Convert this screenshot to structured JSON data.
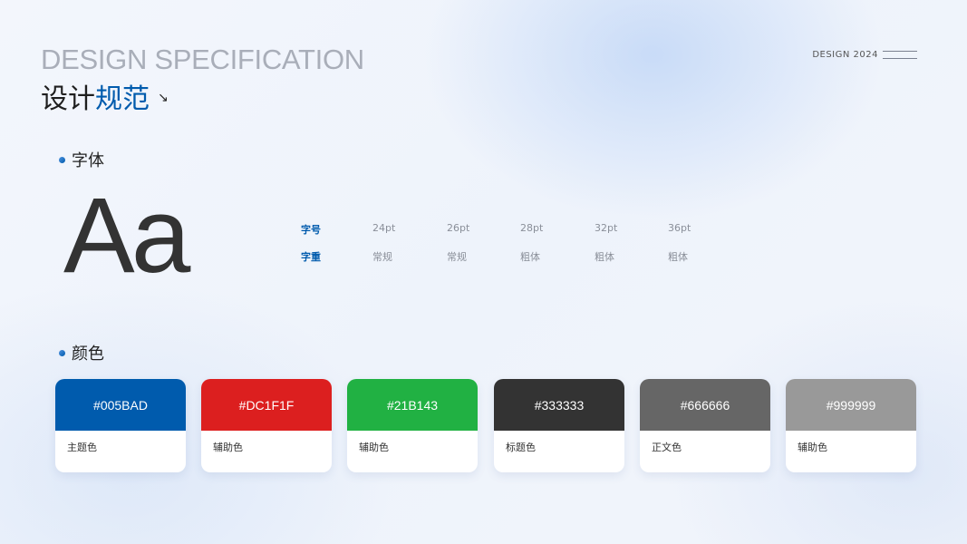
{
  "header": {
    "en_title": "DESIGN SPECIFICATION",
    "cn_title_part1": "设计",
    "cn_title_part2": "规范",
    "arrow": "↘",
    "top_right": "DESIGN 2024"
  },
  "font_section": {
    "title": "字体",
    "sample": "Aa",
    "size_label": "字号",
    "weight_label": "字重",
    "sizes": [
      "24pt",
      "26pt",
      "28pt",
      "32pt",
      "36pt"
    ],
    "weights": [
      "常规",
      "常规",
      "粗体",
      "粗体",
      "粗体"
    ]
  },
  "color_section": {
    "title": "颜色",
    "swatches": [
      {
        "hex": "#005BAD",
        "name": "主题色"
      },
      {
        "hex": "#DC1F1F",
        "name": "辅助色"
      },
      {
        "hex": "#21B143",
        "name": "辅助色"
      },
      {
        "hex": "#333333",
        "name": "标题色"
      },
      {
        "hex": "#666666",
        "name": "正文色"
      },
      {
        "hex": "#999999",
        "name": "辅助色"
      }
    ]
  },
  "colors": {
    "accent": "#005BAD"
  }
}
